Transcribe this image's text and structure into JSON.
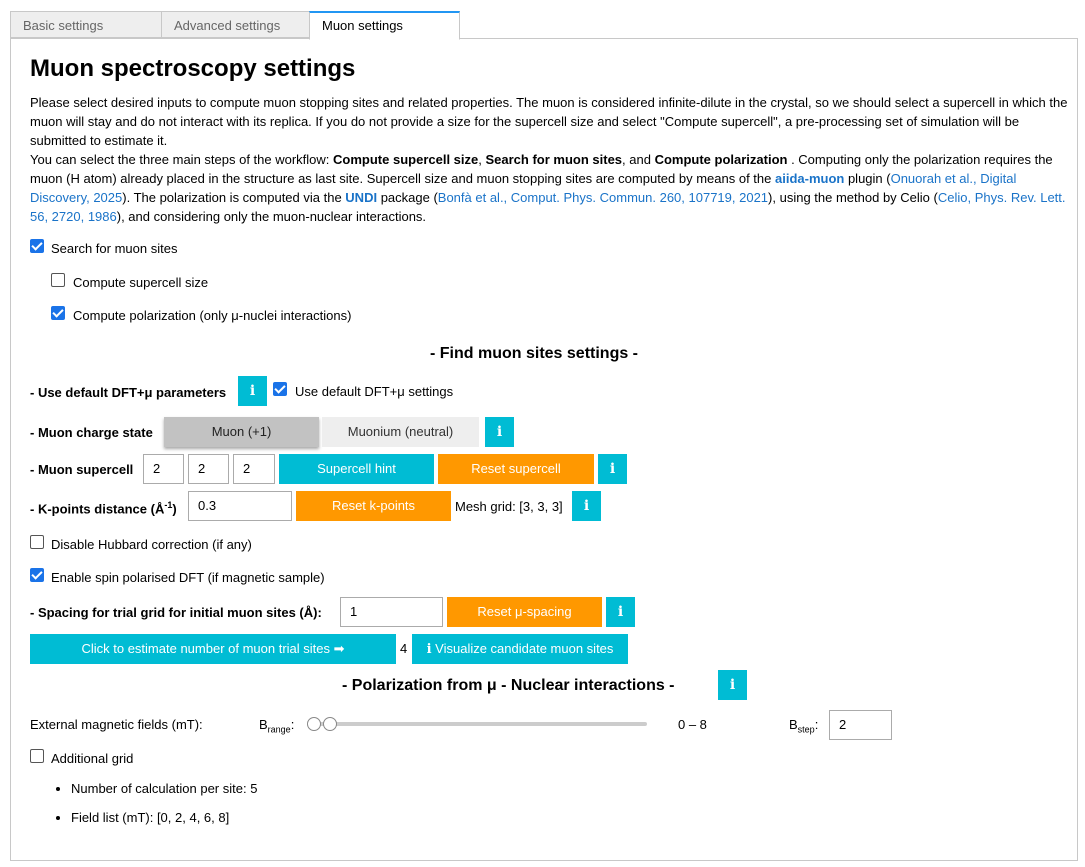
{
  "tabs": [
    {
      "label": "Basic settings"
    },
    {
      "label": "Advanced settings"
    },
    {
      "label": "Muon settings"
    }
  ],
  "title": "Muon spectroscopy settings",
  "intro": {
    "p1": "Please select desired inputs to compute muon stopping sites and related properties. The muon is considered infinite-dilute in the crystal, so we should select a supercell in which the muon will stay and do not interact with its replica. If you do not provide a size for the supercell size and select \"Compute supercell\", a pre-processing set of simulation will be submitted to estimate it.",
    "p2a": "You can select the three main steps of the workflow: ",
    "step1": "Compute supercell size",
    "sep1": ", ",
    "step2": "Search for muon sites",
    "sep2": ", and ",
    "step3": "Compute polarization",
    "p2b": " . Computing only the polarization requires the muon (H atom) already placed in the structure as last site. Supercell size and muon stopping sites are computed by means of the ",
    "aiida_muon": "aiida-muon",
    "p2c": " plugin (",
    "ref1": "Onuorah et al., Digital Discovery, 2025",
    "p2d": "). The polarization is computed via the ",
    "undi": "UNDI",
    "p2e": " package (",
    "ref2": "Bonfà et al., Comput. Phys. Commun. 260, 107719, 2021",
    "p2f": "), using the method by Celio (",
    "ref3": "Celio, Phys. Rev. Lett. 56, 2720, 1986",
    "p2g": "), and considering only the muon-nuclear interactions."
  },
  "options": {
    "search_sites": "Search for muon sites",
    "compute_supercell": "Compute supercell size",
    "compute_polarization": "Compute polarization (only μ-nuclei interactions)"
  },
  "find_section": {
    "heading": "- Find muon sites settings -",
    "dft_label": "- Use default DFT+μ parameters",
    "dft_checkbox": "Use default DFT+μ settings",
    "charge_label": "- Muon charge state",
    "charge_options": [
      "Muon (+1)",
      "Muonium (neutral)"
    ],
    "supercell_label": "- Muon supercell",
    "supercell_values": [
      "2",
      "2",
      "2"
    ],
    "supercell_hint": "Supercell hint",
    "reset_supercell": "Reset supercell",
    "kpoints_label_a": "- K-points distance (Å",
    "kpoints_sup": "-1",
    "kpoints_label_b": ")",
    "kpoints_value": "0.3",
    "reset_kpoints": "Reset k-points",
    "mesh_grid": "Mesh grid: [3, 3, 3]",
    "disable_hubbard": "Disable Hubbard correction (if any)",
    "spin_polarised": "Enable spin polarised DFT (if magnetic sample)",
    "spacing_label": "- Spacing for trial grid for initial muon sites (Å):",
    "spacing_value": "1",
    "reset_spacing": "Reset μ-spacing",
    "estimate_button": "Click to estimate number of muon trial sites ➡",
    "estimate_result": "4",
    "visualize_button": "Visualize candidate muon sites"
  },
  "polarization_section": {
    "heading": "- Polarization from μ - Nuclear interactions -",
    "field_label": "External magnetic fields (mT):",
    "brange_label": "B",
    "brange_sub": "range",
    "brange_value": "0 – 8",
    "bstep_label": "B",
    "bstep_sub": "step",
    "bstep_value": "2",
    "additional_grid": "Additional grid",
    "items": [
      "Number of calculation per site: 5",
      "Field list (mT): [0, 2, 4, 6, 8]"
    ]
  },
  "state": {
    "search_sites": true,
    "compute_supercell": false,
    "compute_polarization": true,
    "use_default_dft": true,
    "disable_hubbard": false,
    "spin_polarised": true,
    "additional_grid": false,
    "selected_charge": "Muon (+1)",
    "brange_min": 0,
    "brange_max": 8
  },
  "colors": {
    "accent_cyan": "#00bcd4",
    "accent_orange": "#ff9800",
    "checkbox_blue": "#1a73e8",
    "link_blue": "#1a73c8"
  }
}
